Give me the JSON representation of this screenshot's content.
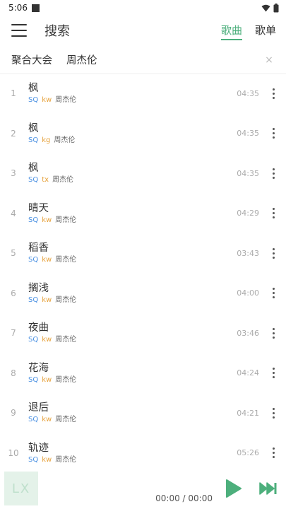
{
  "status": {
    "time": "5:06"
  },
  "header": {
    "title": "搜索",
    "tabs": [
      {
        "label": "歌曲",
        "active": true
      },
      {
        "label": "歌单",
        "active": false
      }
    ]
  },
  "search": {
    "source": "聚合大会",
    "query": "周杰伦",
    "clear": "×"
  },
  "songs": [
    {
      "index": "1",
      "name": "枫",
      "quality": "SQ",
      "source": "kw",
      "artist": "周杰伦",
      "duration": "04:35"
    },
    {
      "index": "2",
      "name": "枫",
      "quality": "SQ",
      "source": "kg",
      "artist": "周杰伦",
      "duration": "04:35"
    },
    {
      "index": "3",
      "name": "枫",
      "quality": "SQ",
      "source": "tx",
      "artist": "周杰伦",
      "duration": "04:35"
    },
    {
      "index": "4",
      "name": "晴天",
      "quality": "SQ",
      "source": "kw",
      "artist": "周杰伦",
      "duration": "04:29"
    },
    {
      "index": "5",
      "name": "稻香",
      "quality": "SQ",
      "source": "kw",
      "artist": "周杰伦",
      "duration": "03:43"
    },
    {
      "index": "6",
      "name": "搁浅",
      "quality": "SQ",
      "source": "kw",
      "artist": "周杰伦",
      "duration": "04:00"
    },
    {
      "index": "7",
      "name": "夜曲",
      "quality": "SQ",
      "source": "kw",
      "artist": "周杰伦",
      "duration": "03:46"
    },
    {
      "index": "8",
      "name": "花海",
      "quality": "SQ",
      "source": "kw",
      "artist": "周杰伦",
      "duration": "04:24"
    },
    {
      "index": "9",
      "name": "退后",
      "quality": "SQ",
      "source": "kw",
      "artist": "周杰伦",
      "duration": "04:21"
    },
    {
      "index": "10",
      "name": "轨迹",
      "quality": "SQ",
      "source": "kw",
      "artist": "周杰伦",
      "duration": "05:26"
    }
  ],
  "player": {
    "logo": "LX",
    "time": "00:00 / 00:00"
  },
  "colors": {
    "accent": "#4daf7c",
    "quality_tag": "#4a90e2",
    "source_tag": "#e6a23c"
  },
  "icons": [
    "menu-icon",
    "close-icon",
    "more-vertical-icon",
    "play-icon",
    "next-icon",
    "wifi-icon",
    "battery-icon"
  ]
}
